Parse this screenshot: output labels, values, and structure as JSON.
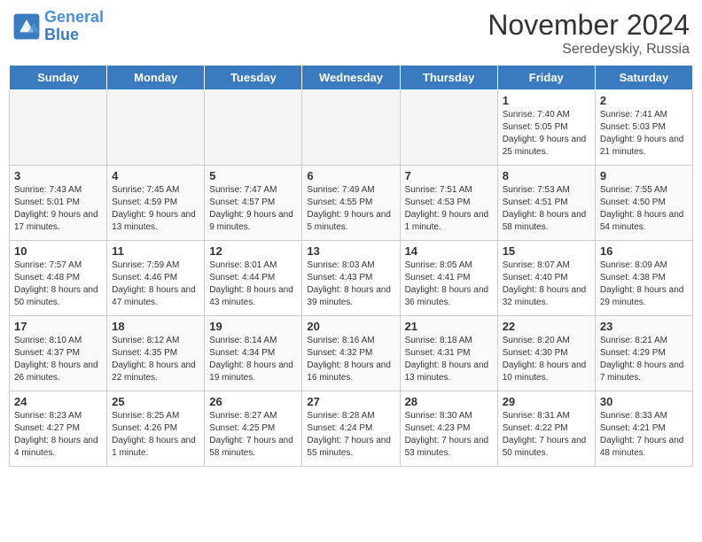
{
  "header": {
    "logo_line1": "General",
    "logo_line2": "Blue",
    "month_title": "November 2024",
    "location": "Seredeyskiy, Russia"
  },
  "days_of_week": [
    "Sunday",
    "Monday",
    "Tuesday",
    "Wednesday",
    "Thursday",
    "Friday",
    "Saturday"
  ],
  "weeks": [
    [
      {
        "day": "",
        "info": ""
      },
      {
        "day": "",
        "info": ""
      },
      {
        "day": "",
        "info": ""
      },
      {
        "day": "",
        "info": ""
      },
      {
        "day": "",
        "info": ""
      },
      {
        "day": "1",
        "info": "Sunrise: 7:40 AM\nSunset: 5:05 PM\nDaylight: 9 hours and 25 minutes."
      },
      {
        "day": "2",
        "info": "Sunrise: 7:41 AM\nSunset: 5:03 PM\nDaylight: 9 hours and 21 minutes."
      }
    ],
    [
      {
        "day": "3",
        "info": "Sunrise: 7:43 AM\nSunset: 5:01 PM\nDaylight: 9 hours and 17 minutes."
      },
      {
        "day": "4",
        "info": "Sunrise: 7:45 AM\nSunset: 4:59 PM\nDaylight: 9 hours and 13 minutes."
      },
      {
        "day": "5",
        "info": "Sunrise: 7:47 AM\nSunset: 4:57 PM\nDaylight: 9 hours and 9 minutes."
      },
      {
        "day": "6",
        "info": "Sunrise: 7:49 AM\nSunset: 4:55 PM\nDaylight: 9 hours and 5 minutes."
      },
      {
        "day": "7",
        "info": "Sunrise: 7:51 AM\nSunset: 4:53 PM\nDaylight: 9 hours and 1 minute."
      },
      {
        "day": "8",
        "info": "Sunrise: 7:53 AM\nSunset: 4:51 PM\nDaylight: 8 hours and 58 minutes."
      },
      {
        "day": "9",
        "info": "Sunrise: 7:55 AM\nSunset: 4:50 PM\nDaylight: 8 hours and 54 minutes."
      }
    ],
    [
      {
        "day": "10",
        "info": "Sunrise: 7:57 AM\nSunset: 4:48 PM\nDaylight: 8 hours and 50 minutes."
      },
      {
        "day": "11",
        "info": "Sunrise: 7:59 AM\nSunset: 4:46 PM\nDaylight: 8 hours and 47 minutes."
      },
      {
        "day": "12",
        "info": "Sunrise: 8:01 AM\nSunset: 4:44 PM\nDaylight: 8 hours and 43 minutes."
      },
      {
        "day": "13",
        "info": "Sunrise: 8:03 AM\nSunset: 4:43 PM\nDaylight: 8 hours and 39 minutes."
      },
      {
        "day": "14",
        "info": "Sunrise: 8:05 AM\nSunset: 4:41 PM\nDaylight: 8 hours and 36 minutes."
      },
      {
        "day": "15",
        "info": "Sunrise: 8:07 AM\nSunset: 4:40 PM\nDaylight: 8 hours and 32 minutes."
      },
      {
        "day": "16",
        "info": "Sunrise: 8:09 AM\nSunset: 4:38 PM\nDaylight: 8 hours and 29 minutes."
      }
    ],
    [
      {
        "day": "17",
        "info": "Sunrise: 8:10 AM\nSunset: 4:37 PM\nDaylight: 8 hours and 26 minutes."
      },
      {
        "day": "18",
        "info": "Sunrise: 8:12 AM\nSunset: 4:35 PM\nDaylight: 8 hours and 22 minutes."
      },
      {
        "day": "19",
        "info": "Sunrise: 8:14 AM\nSunset: 4:34 PM\nDaylight: 8 hours and 19 minutes."
      },
      {
        "day": "20",
        "info": "Sunrise: 8:16 AM\nSunset: 4:32 PM\nDaylight: 8 hours and 16 minutes."
      },
      {
        "day": "21",
        "info": "Sunrise: 8:18 AM\nSunset: 4:31 PM\nDaylight: 8 hours and 13 minutes."
      },
      {
        "day": "22",
        "info": "Sunrise: 8:20 AM\nSunset: 4:30 PM\nDaylight: 8 hours and 10 minutes."
      },
      {
        "day": "23",
        "info": "Sunrise: 8:21 AM\nSunset: 4:29 PM\nDaylight: 8 hours and 7 minutes."
      }
    ],
    [
      {
        "day": "24",
        "info": "Sunrise: 8:23 AM\nSunset: 4:27 PM\nDaylight: 8 hours and 4 minutes."
      },
      {
        "day": "25",
        "info": "Sunrise: 8:25 AM\nSunset: 4:26 PM\nDaylight: 8 hours and 1 minute."
      },
      {
        "day": "26",
        "info": "Sunrise: 8:27 AM\nSunset: 4:25 PM\nDaylight: 7 hours and 58 minutes."
      },
      {
        "day": "27",
        "info": "Sunrise: 8:28 AM\nSunset: 4:24 PM\nDaylight: 7 hours and 55 minutes."
      },
      {
        "day": "28",
        "info": "Sunrise: 8:30 AM\nSunset: 4:23 PM\nDaylight: 7 hours and 53 minutes."
      },
      {
        "day": "29",
        "info": "Sunrise: 8:31 AM\nSunset: 4:22 PM\nDaylight: 7 hours and 50 minutes."
      },
      {
        "day": "30",
        "info": "Sunrise: 8:33 AM\nSunset: 4:21 PM\nDaylight: 7 hours and 48 minutes."
      }
    ]
  ]
}
